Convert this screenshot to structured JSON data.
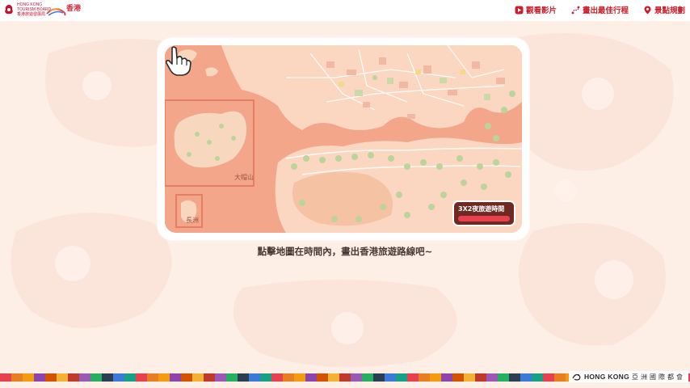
{
  "header": {
    "hktb_logo_lines": [
      "HONG KONG",
      "TOURISM BOARD",
      "香港旅遊發展局"
    ],
    "brand_logo_text": "香港",
    "nav": [
      {
        "label": "觀看影片",
        "icon": "play-icon"
      },
      {
        "label": "畫出最佳行程",
        "icon": "route-icon"
      },
      {
        "label": "景點規劃",
        "icon": "location-pin-icon"
      }
    ]
  },
  "game": {
    "timer_label": "3X2夜旅遊時間",
    "timer_progress": 1.0,
    "map_labels": {
      "tai_mo_shan": "大帽山",
      "cheung_chau": "長洲"
    },
    "instruction": "點擊地圖在時間內，畫出香港旅遊路線吧~"
  },
  "footer": {
    "brand": "HONG KONG",
    "club": "亞洲國際都會"
  },
  "colors": {
    "accent": "#c8202e",
    "map_sea": "#f3a68a",
    "background": "#fdeee6",
    "timer_bg": "#6e2a22"
  }
}
